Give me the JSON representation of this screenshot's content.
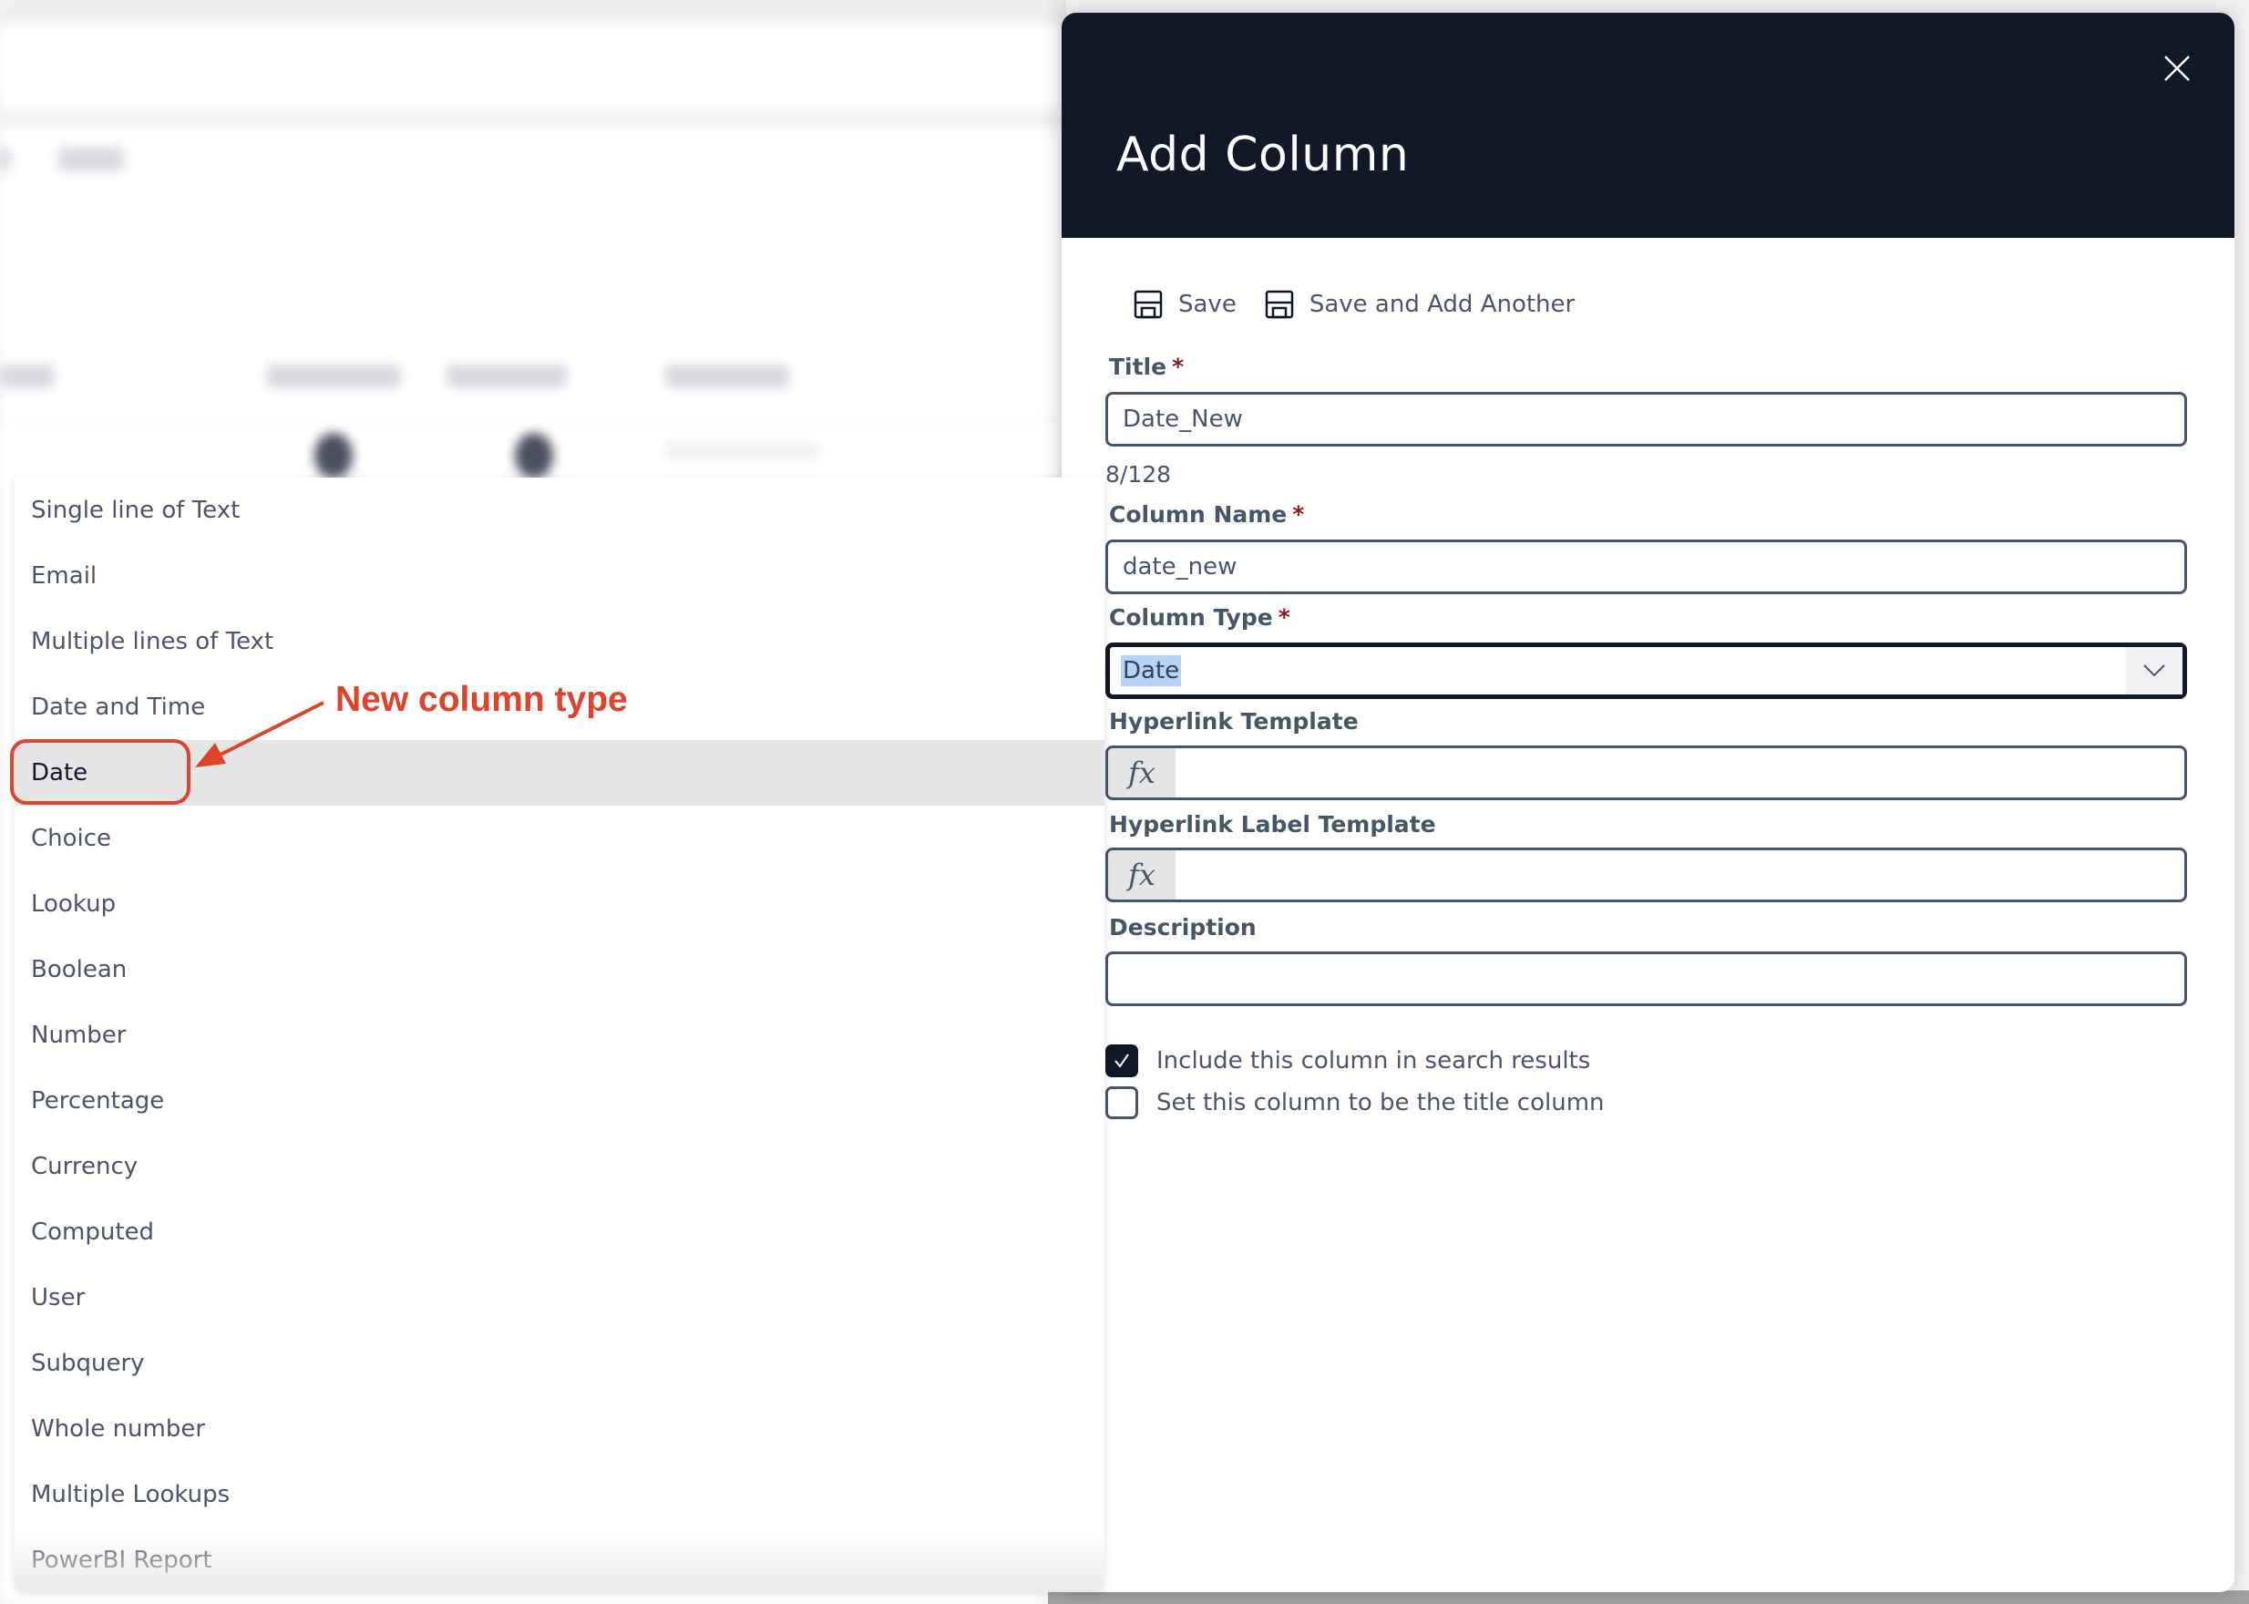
{
  "panel": {
    "title": "Add Column",
    "close_label": "Close",
    "toolbar": {
      "save_label": "Save",
      "save_and_add_label": "Save and Add Another"
    },
    "fields": {
      "title": {
        "label": "Title",
        "required_mark": "*",
        "value": "Date_New",
        "counter": "8/128"
      },
      "column_name": {
        "label": "Column Name",
        "required_mark": "*",
        "value": "date_new"
      },
      "column_type": {
        "label": "Column Type",
        "required_mark": "*",
        "value": "Date"
      },
      "hyperlink_template": {
        "label": "Hyperlink Template",
        "prefix": "fx",
        "value": ""
      },
      "hyperlink_label_template": {
        "label": "Hyperlink Label Template",
        "prefix": "fx",
        "value": ""
      },
      "description": {
        "label": "Description",
        "value": ""
      }
    },
    "checkboxes": [
      {
        "label": "Include this column in search results",
        "checked": true
      },
      {
        "label": "Set this column to be the title column",
        "checked": false
      }
    ]
  },
  "column_type_dropdown": {
    "highlighted": "Date",
    "options": [
      "Single line of Text",
      "Email",
      "Multiple lines of Text",
      "Date and Time",
      "Date",
      "Choice",
      "Lookup",
      "Boolean",
      "Number",
      "Percentage",
      "Currency",
      "Computed",
      "User",
      "Subquery",
      "Whole number",
      "Multiple Lookups",
      "PowerBI Report"
    ]
  },
  "annotation": {
    "text": "New column type",
    "color": "#e0432b"
  },
  "colors": {
    "header_bg": "#111827",
    "label_text": "#475569",
    "required": "#8b1a1a",
    "selection_highlight": "#b7d2f7"
  }
}
